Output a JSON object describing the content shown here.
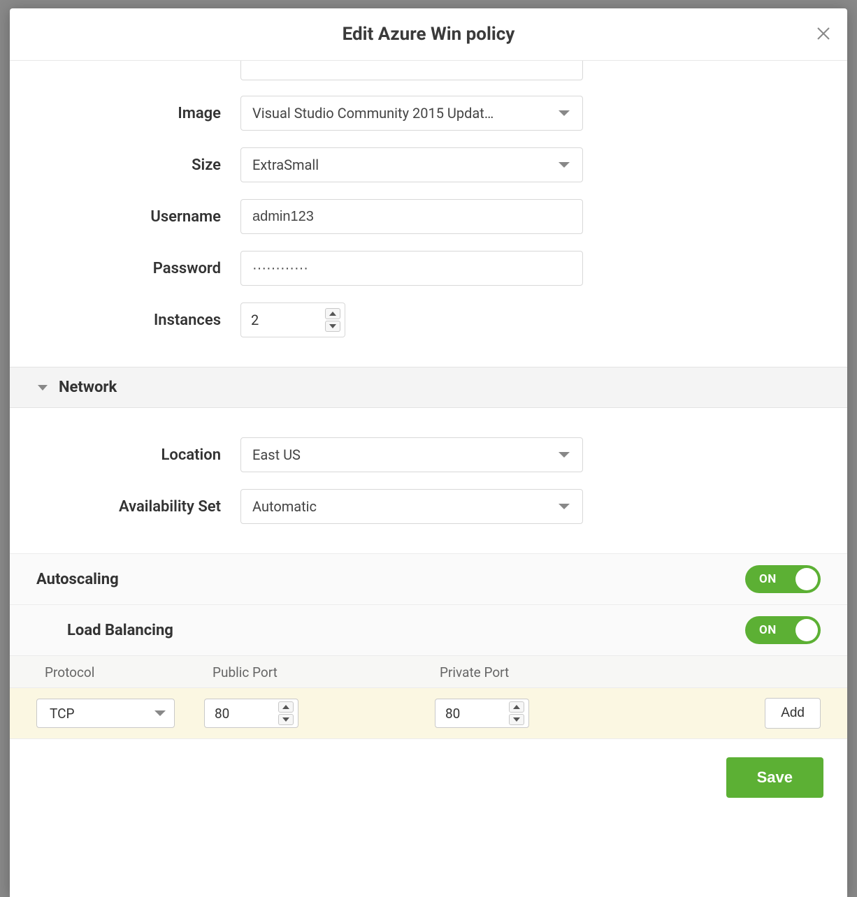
{
  "modal": {
    "title": "Edit Azure Win policy"
  },
  "form": {
    "image_label": "Image",
    "image_value": "Visual Studio Community 2015 Updat…",
    "size_label": "Size",
    "size_value": "ExtraSmall",
    "username_label": "Username",
    "username_value": "admin123",
    "password_label": "Password",
    "password_value": "············",
    "instances_label": "Instances",
    "instances_value": "2"
  },
  "network": {
    "section_title": "Network",
    "location_label": "Location",
    "location_value": "East US",
    "availset_label": "Availability Set",
    "availset_value": "Automatic"
  },
  "autoscaling": {
    "label": "Autoscaling",
    "toggle": "ON"
  },
  "loadbalancing": {
    "label": "Load Balancing",
    "toggle": "ON",
    "columns": {
      "protocol": "Protocol",
      "public_port": "Public Port",
      "private_port": "Private Port"
    },
    "row": {
      "protocol": "TCP",
      "public_port": "80",
      "private_port": "80",
      "add_label": "Add"
    }
  },
  "footer": {
    "save_label": "Save"
  }
}
